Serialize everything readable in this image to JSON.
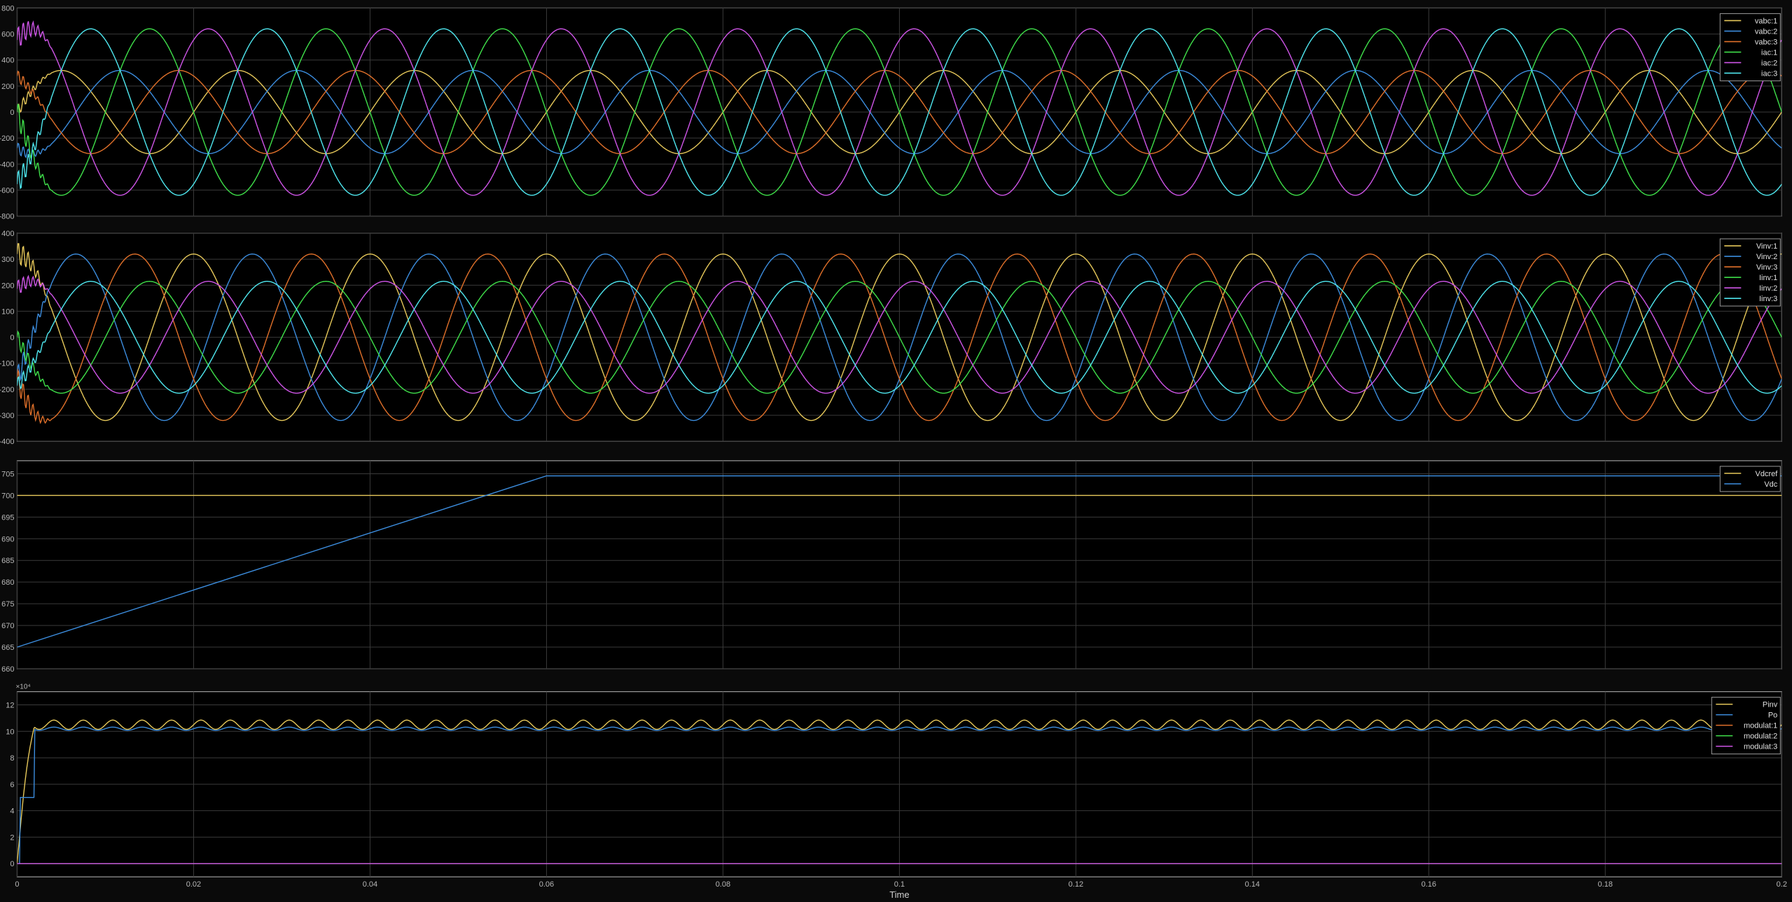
{
  "chart_data": [
    {
      "type": "line",
      "title": "",
      "xlabel": "",
      "ylabel": "",
      "xlim": [
        0,
        0.2
      ],
      "ylim": [
        -800,
        800
      ],
      "yticks": [
        "800",
        "600",
        "400",
        "200",
        "0",
        "-200",
        "-400",
        "-600",
        "-800"
      ],
      "grid": true,
      "legend_position": "top-right",
      "series": [
        {
          "name": "vabc:1",
          "color": "#e6c85a",
          "peak": 320,
          "phase_deg": 0,
          "freq_hz": 50
        },
        {
          "name": "vabc:2",
          "color": "#3c8dde",
          "peak": 320,
          "phase_deg": -120,
          "freq_hz": 50
        },
        {
          "name": "vabc:3",
          "color": "#e0702a",
          "peak": 320,
          "phase_deg": 120,
          "freq_hz": 50
        },
        {
          "name": "iac:1",
          "color": "#3fe04a",
          "peak": 640,
          "phase_deg": 180,
          "freq_hz": 50
        },
        {
          "name": "iac:2",
          "color": "#cf55e8",
          "peak": 640,
          "phase_deg": 60,
          "freq_hz": 50
        },
        {
          "name": "iac:3",
          "color": "#4fe8f0",
          "peak": 640,
          "phase_deg": -60,
          "freq_hz": 50
        }
      ]
    },
    {
      "type": "line",
      "title": "",
      "xlabel": "",
      "ylabel": "",
      "xlim": [
        0,
        0.2
      ],
      "ylim": [
        -400,
        400
      ],
      "yticks": [
        "400",
        "300",
        "200",
        "100",
        "0",
        "-100",
        "-200",
        "-300",
        "-400"
      ],
      "grid": true,
      "legend_position": "top-right",
      "series": [
        {
          "name": "Vinv:1",
          "color": "#e6c85a",
          "peak": 320,
          "phase_deg": 90,
          "freq_hz": 50
        },
        {
          "name": "Vinv:2",
          "color": "#3c8dde",
          "peak": 320,
          "phase_deg": -30,
          "freq_hz": 50
        },
        {
          "name": "Vinv:3",
          "color": "#e0702a",
          "peak": 320,
          "phase_deg": 210,
          "freq_hz": 50
        },
        {
          "name": "Iinv:1",
          "color": "#3fe04a",
          "peak": 215,
          "phase_deg": 180,
          "freq_hz": 50
        },
        {
          "name": "Iinv:2",
          "color": "#cf55e8",
          "peak": 215,
          "phase_deg": 60,
          "freq_hz": 50
        },
        {
          "name": "Iinv:3",
          "color": "#4fe8f0",
          "peak": 215,
          "phase_deg": -60,
          "freq_hz": 50
        }
      ]
    },
    {
      "type": "line",
      "title": "",
      "xlabel": "",
      "ylabel": "",
      "xlim": [
        0,
        0.2
      ],
      "ylim": [
        660,
        708
      ],
      "yticks": [
        "705",
        "700",
        "695",
        "690",
        "685",
        "680",
        "675",
        "670",
        "665",
        "660"
      ],
      "grid": true,
      "legend_position": "top-right",
      "series": [
        {
          "name": "Vdcref",
          "color": "#e6c85a",
          "x": [
            0,
            0.2
          ],
          "y": [
            700,
            700
          ]
        },
        {
          "name": "Vdc",
          "color": "#3c8dde",
          "x": [
            0,
            0.06,
            0.2
          ],
          "y": [
            665,
            704.5,
            704.5
          ]
        }
      ]
    },
    {
      "type": "line",
      "title": "",
      "xlabel": "Time",
      "ylabel": "",
      "xlim": [
        0,
        0.2
      ],
      "ylim": [
        -1,
        13
      ],
      "y_multiplier": "×10⁴",
      "yticks": [
        "12",
        "10",
        "8",
        "6",
        "4",
        "2",
        "0"
      ],
      "xticks": [
        "0",
        "0.02",
        "0.04",
        "0.06",
        "0.08",
        "0.1",
        "0.12",
        "0.14",
        "0.16",
        "0.18",
        "0.2"
      ],
      "grid": true,
      "legend_position": "top-right",
      "series": [
        {
          "name": "Pinv",
          "color": "#e6c85a",
          "level": 10.5,
          "ripple": 0.35
        },
        {
          "name": "Po",
          "color": "#3c8dde",
          "level": 10.2,
          "ripple": 0.12
        },
        {
          "name": "modulat:1",
          "color": "#e0702a",
          "level": 0
        },
        {
          "name": "modulat:2",
          "color": "#3fe04a",
          "level": 0
        },
        {
          "name": "modulat:3",
          "color": "#cf55e8",
          "level": 0
        }
      ]
    }
  ]
}
